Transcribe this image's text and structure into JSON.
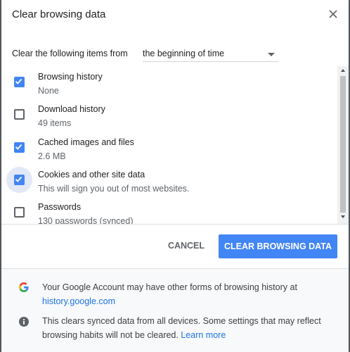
{
  "dialog": {
    "title": "Clear browsing data",
    "close_icon": "close-icon"
  },
  "time_range": {
    "label": "Clear the following items from",
    "selected": "the beginning of time"
  },
  "items": [
    {
      "label": "Browsing history",
      "detail": "None",
      "checked": true
    },
    {
      "label": "Download history",
      "detail": "49 items",
      "checked": false
    },
    {
      "label": "Cached images and files",
      "detail": "2.6 MB",
      "checked": true
    },
    {
      "label": "Cookies and other site data",
      "detail": "This will sign you out of most websites.",
      "checked": true
    },
    {
      "label": "Passwords",
      "detail": "130 passwords (synced)",
      "checked": false
    }
  ],
  "buttons": {
    "cancel": "CANCEL",
    "clear": "CLEAR BROWSING DATA"
  },
  "footer": {
    "google_text": "Your Google Account may have other forms of browsing history at",
    "google_link": "history.google.com",
    "sync_text": "This clears synced data from all devices. Some settings that may reflect browsing habits will not be cleared.",
    "learn_more": "Learn more"
  },
  "colors": {
    "accent": "#4285f4",
    "checkbox_focus": "#e2e8f7"
  }
}
